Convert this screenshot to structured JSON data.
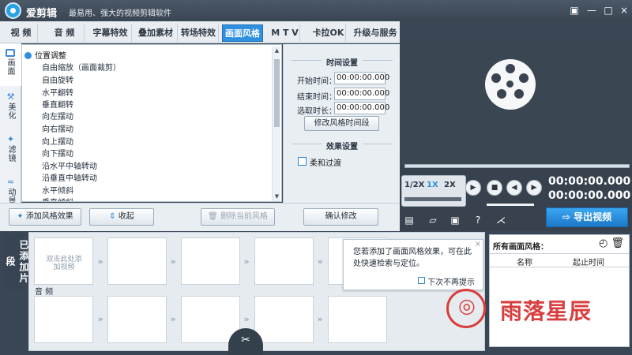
{
  "app": {
    "name": "爱剪辑",
    "slogan": "最易用、强大的视频剪辑软件"
  },
  "window_controls": {
    "skin": "皮肤图标",
    "minimize": "—",
    "maximize": "□",
    "close": "×"
  },
  "tabs": [
    {
      "label": "视 频"
    },
    {
      "label": "音 频"
    },
    {
      "label": "字幕特效"
    },
    {
      "label": "叠加素材"
    },
    {
      "label": "转场特效"
    },
    {
      "label": "画面风格"
    },
    {
      "label": "M T V"
    },
    {
      "label": "卡拉OK"
    },
    {
      "label": "升级与服务"
    }
  ],
  "vertical_tabs": [
    {
      "label": "画面"
    },
    {
      "label": "美化"
    },
    {
      "label": "滤镜"
    },
    {
      "label": "动景"
    }
  ],
  "effect_list": {
    "group": "位置调整",
    "items": [
      "自由缩放（画面裁剪）",
      "自由旋转",
      "水平翻转",
      "垂直翻转",
      "向左摆动",
      "向右摆动",
      "向上摆动",
      "向下摆动",
      "沿水平中轴转动",
      "沿垂直中轴转动",
      "水平倾斜",
      "垂直倾斜"
    ]
  },
  "settings": {
    "time_title": "时间设置",
    "start_label": "开始时间：",
    "start_value": "00:00:00.000",
    "end_label": "结束时间：",
    "end_value": "00:00:00.000",
    "duration_label": "选取时长：",
    "duration_value": "00:00:00.000",
    "modify_time_button": "修改风格时间段",
    "effect_title": "效果设置",
    "soft_transition": "柔和过渡",
    "confirm_button": "确认修改"
  },
  "actions": {
    "add_effect": "添加风格效果",
    "collect": "收起",
    "delete_current": "删除当前风格"
  },
  "player": {
    "speed_options": [
      "1/2X",
      "1X",
      "2X"
    ],
    "time_current": "00:00:00.000",
    "time_total": "00:00:00.000",
    "export": "导出视频"
  },
  "side_add": {
    "label": "已添加片段"
  },
  "clips": {
    "placeholder": "双击此处添加视频",
    "audio_label": "音 频"
  },
  "tooltip": {
    "text": "您若添加了画面风格效果，可在此处快速检索与定位。",
    "no_remind": "下次不再提示"
  },
  "all_effects": {
    "title": "所有画面风格：",
    "col_name": "名称",
    "col_time": "起止时间"
  },
  "watermark": {
    "mark": "雨落星辰",
    "icon": "◎"
  },
  "colors": {
    "accent": "#2f90e0",
    "dark": "#3b4654",
    "brand_red": "#d83e3e"
  }
}
